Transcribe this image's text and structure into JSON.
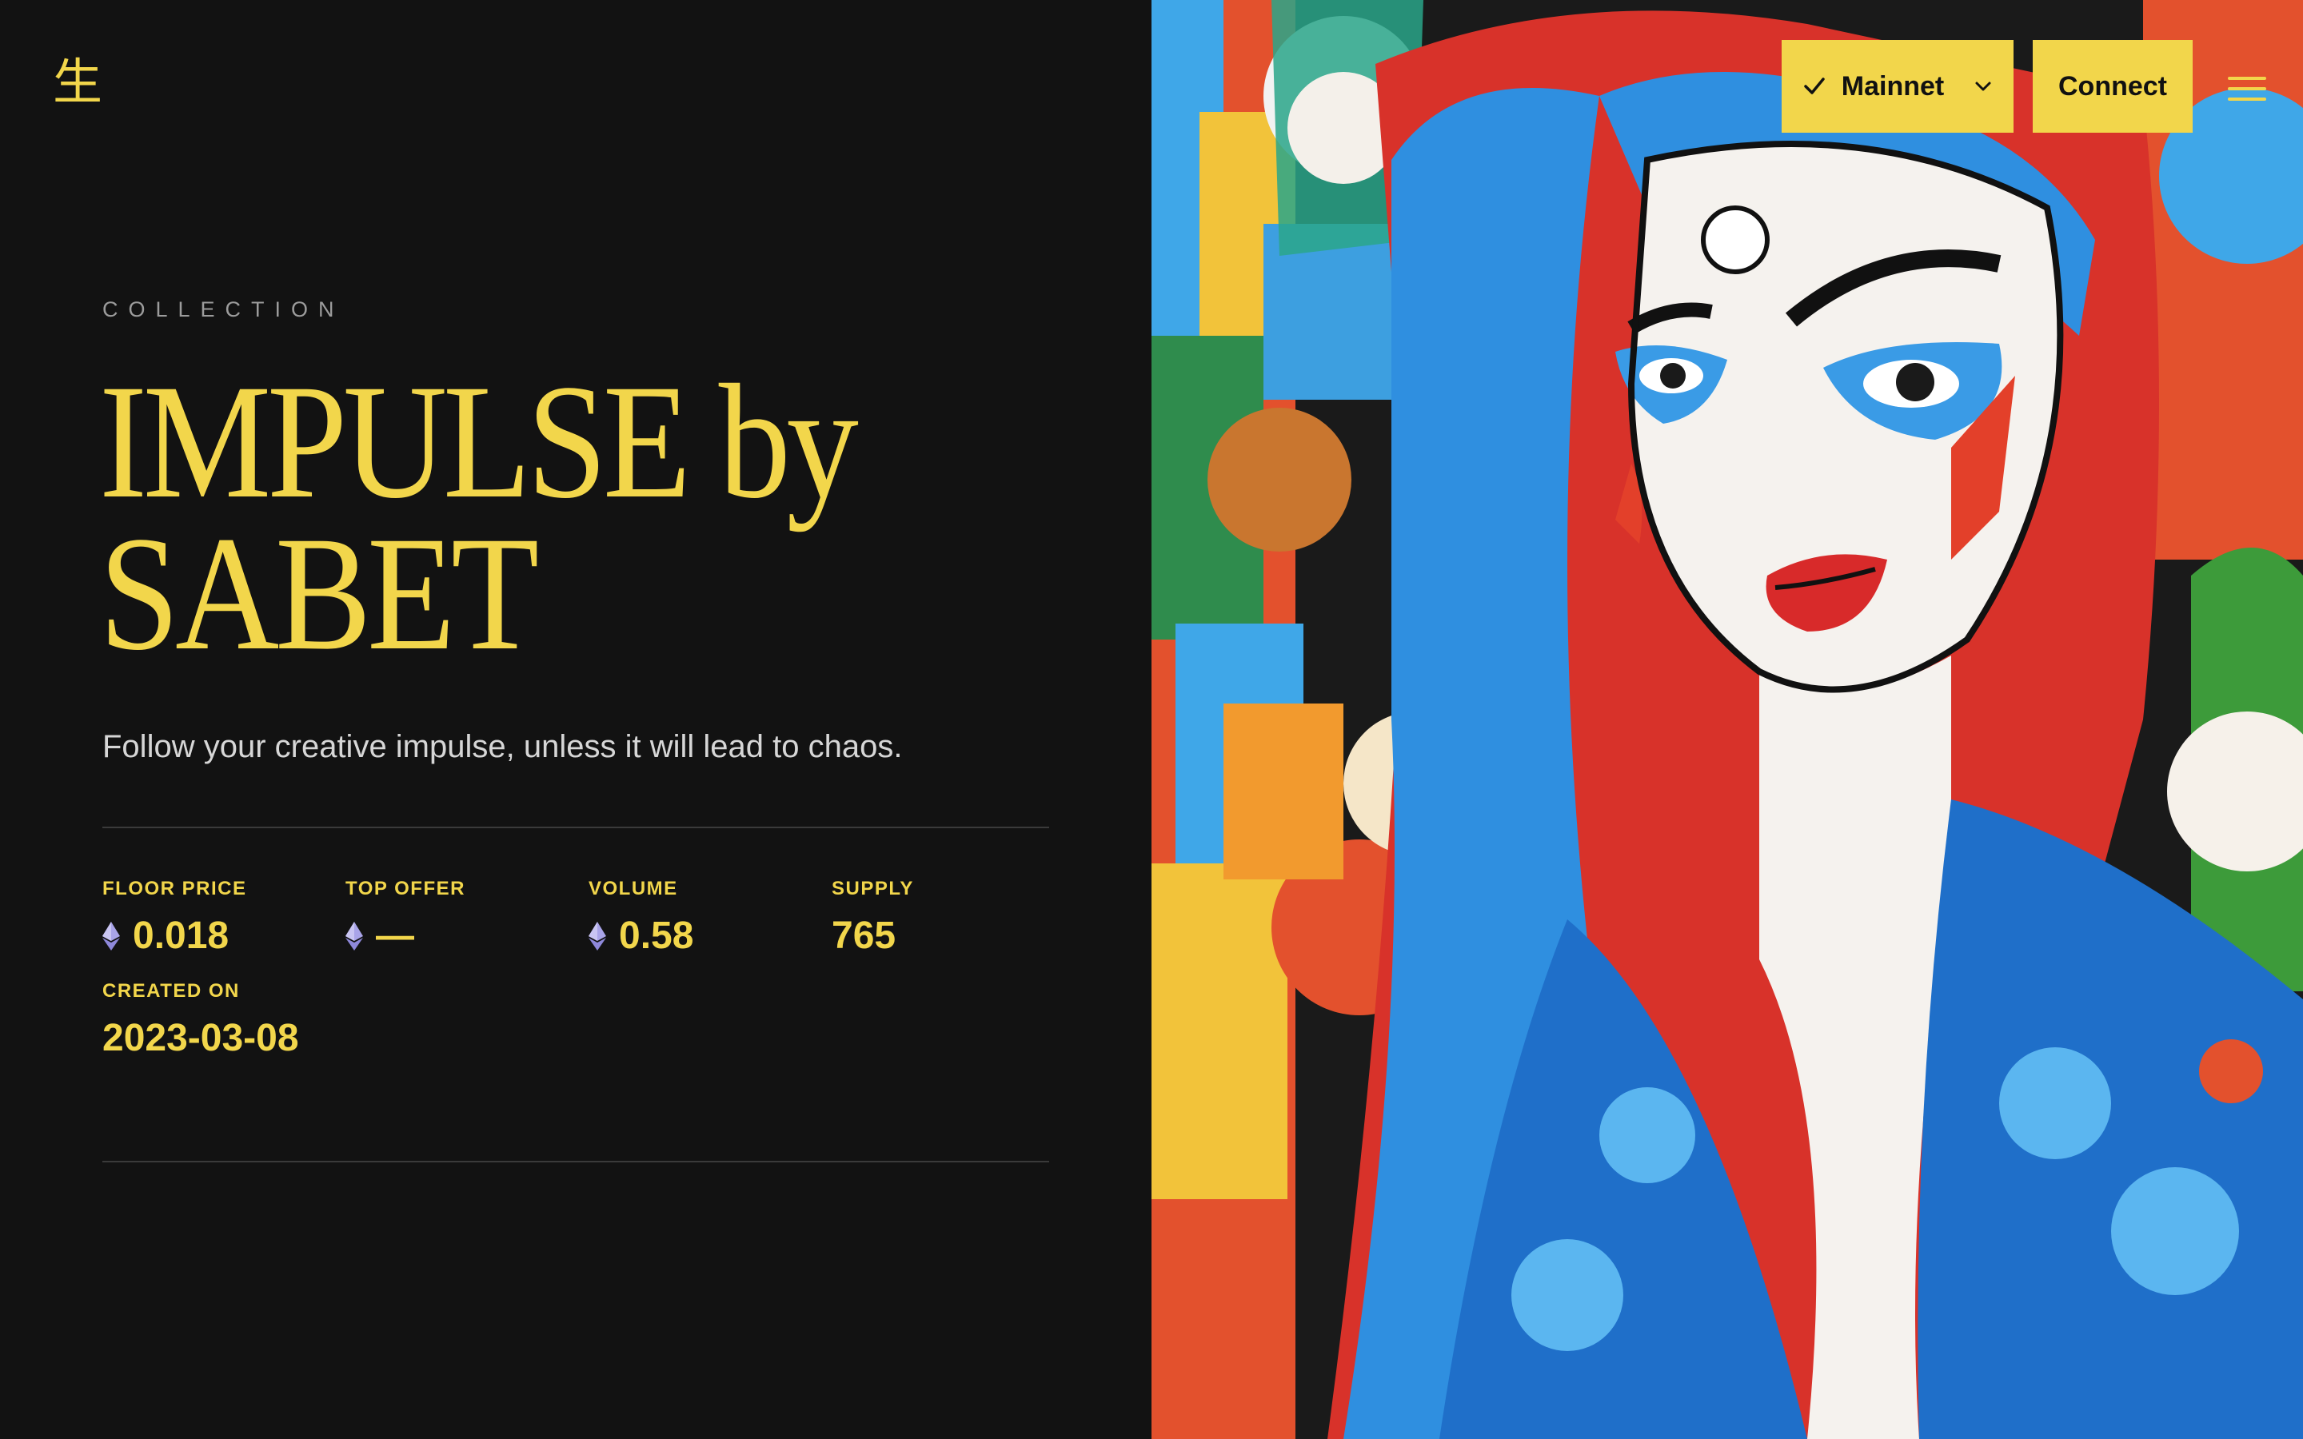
{
  "header": {
    "logo": "生",
    "network_label": "Mainnet",
    "connect_label": "Connect"
  },
  "collection": {
    "eyebrow": "COLLECTION",
    "title_line1": "IMPULSE by",
    "title_line2": "SABET",
    "tagline": "Follow your creative impulse, unless it will lead to chaos."
  },
  "stats": {
    "floor_price": {
      "label": "FLOOR PRICE",
      "value": "0.018"
    },
    "top_offer": {
      "label": "TOP OFFER",
      "value": "—"
    },
    "volume": {
      "label": "VOLUME",
      "value": "0.58"
    },
    "supply": {
      "label": "SUPPLY",
      "value": "765"
    },
    "created_on": {
      "label": "CREATED ON",
      "value": "2023-03-08"
    }
  },
  "colors": {
    "accent": "#f2d64b",
    "background": "#121212",
    "muted_text": "#9c9c9c",
    "body_text": "#d6d6d6",
    "eth_icon": "#a9a4e8"
  },
  "icons": {
    "network_check": "checkmark-icon",
    "network_dropdown": "chevron-down-icon",
    "menu": "hamburger-menu-icon",
    "currency": "ethereum-icon"
  }
}
